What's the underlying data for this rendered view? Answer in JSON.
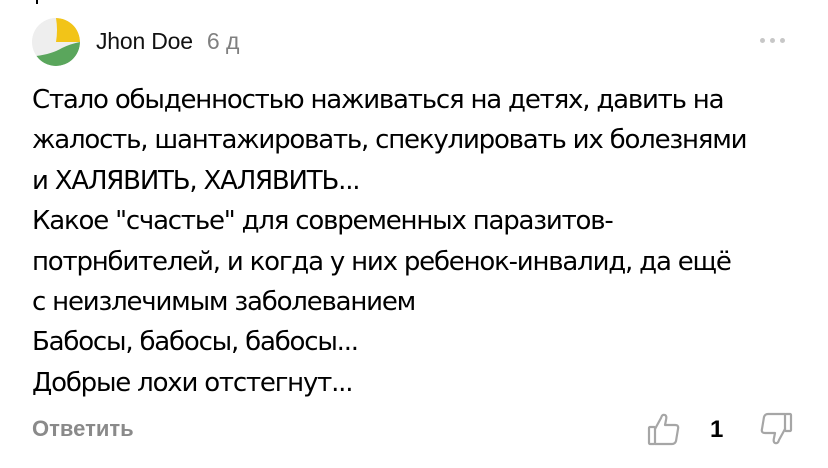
{
  "comment": {
    "author": "Jhon Doe",
    "time": "6 д",
    "lines": [
      "Стало обыденностью наживаться на детях, давить на",
      "жалость, шантажировать, спекулировать их болезнями",
      "и ХАЛЯВИТЬ, ХАЛЯВИТЬ...",
      "Какое \"счастье\" для современных паразитов-",
      "потрнбителей, и когда у них ребенок-инвалид, да ещё",
      "с неизлечимым заболеванием",
      "Бабосы, бабосы, бабосы...",
      "Добрые лохи отстегнут..."
    ]
  },
  "actions": {
    "reply_label": "Ответить",
    "like_count": "1"
  },
  "icons": {
    "avatar": "avatar-icon",
    "more": "more-icon",
    "like": "thumbs-up-icon",
    "dislike": "thumbs-down-icon"
  },
  "colors": {
    "avatar_yellow": "#f2c418",
    "avatar_green": "#5aa65c",
    "muted_text": "#8a8a8a",
    "time_text": "#808080",
    "icon_stroke": "#a6a6a6"
  }
}
